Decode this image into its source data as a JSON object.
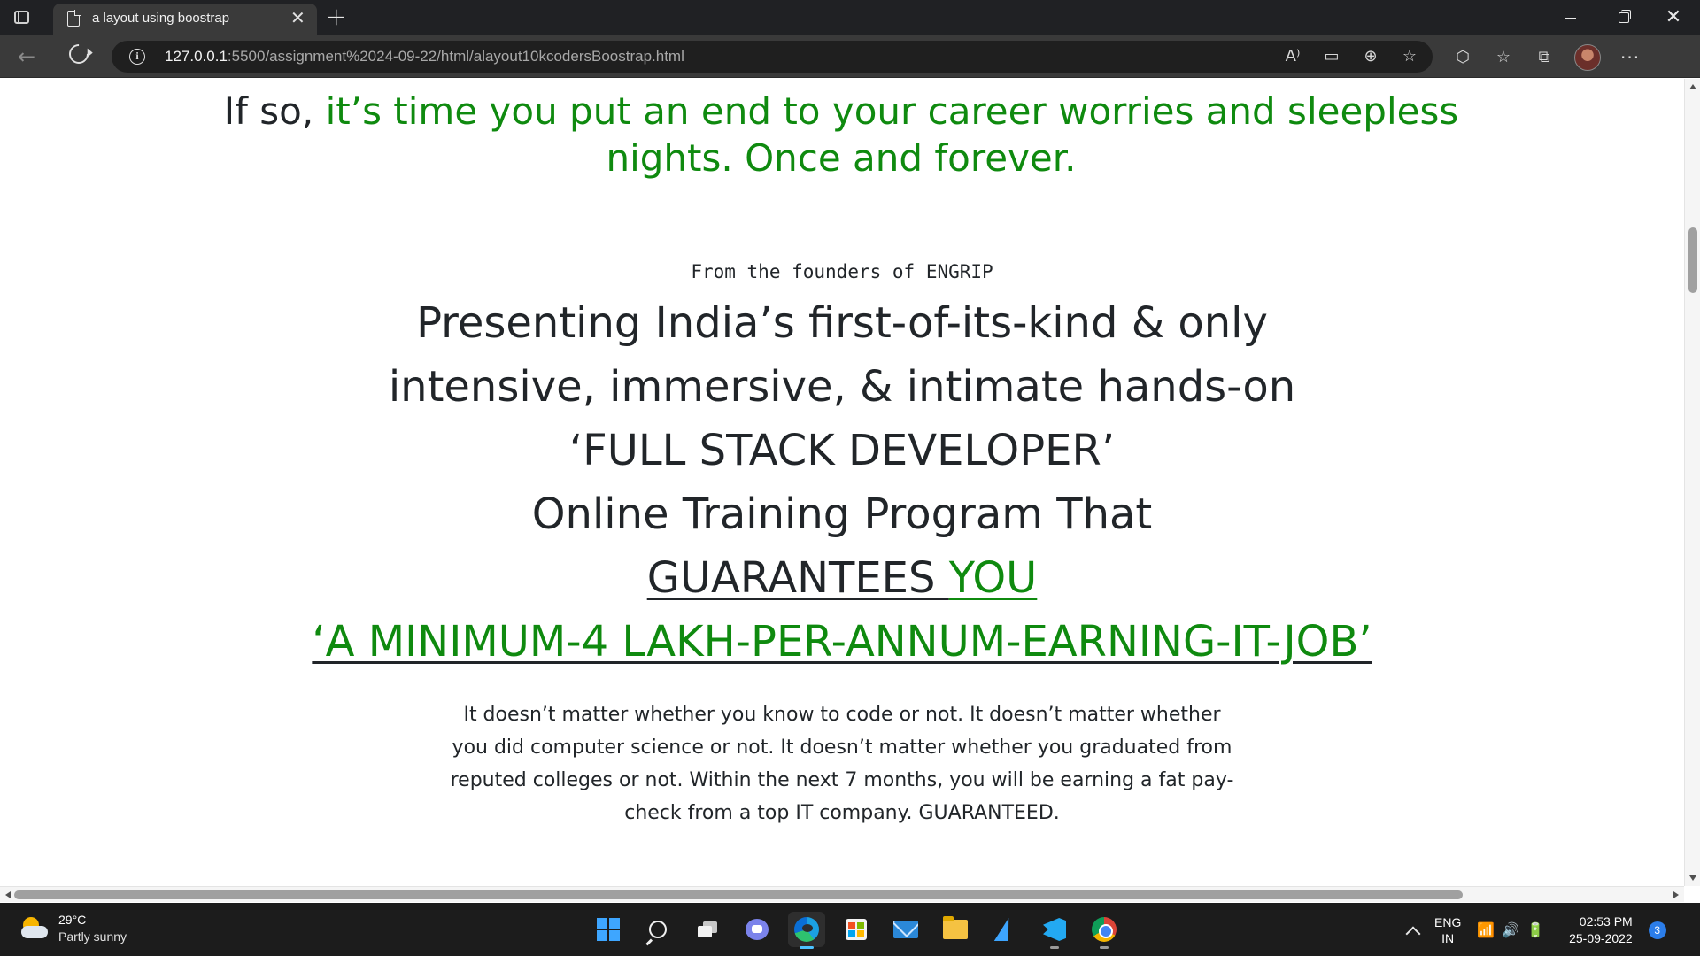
{
  "browser": {
    "tab_title": "a layout using boostrap",
    "tab_close": "✕",
    "new_tab": "+",
    "url_host": "127.0.0.1",
    "url_path": ":5500/assignment%2024-09-22/html/alayout10kcodersBoostrap.html"
  },
  "page": {
    "hero_prefix": "If so, ",
    "hero_green": "it’s time you put an end to your career worries and sleepless nights. Once and forever.",
    "founders": "From the founders of ENGRIP",
    "headline_1": "Presenting India’s first-of-its-kind & only",
    "headline_2": "intensive, immersive, & intimate hands-on",
    "headline_3": "‘FULL STACK DEVELOPER’",
    "headline_4": "Online Training Program That",
    "guarantee_dark": "GUARANTEES ",
    "guarantee_green": "YOU",
    "job_line": "‘A MINIMUM-4 LAKH-PER-ANNUM-EARNING-IT-JOB’",
    "description": "It doesn’t matter whether you know to code or not. It doesn’t matter whether you did computer science or not. It doesn’t matter whether you graduated from reputed colleges or not. Within the next 7 months, you will be earning a fat pay-check from a top IT company. GUARANTEED."
  },
  "colors": {
    "accent_green": "#0f8a0f",
    "text_dark": "#212529"
  },
  "taskbar": {
    "weather_temp": "29°C",
    "weather_desc": "Partly sunny",
    "lang_1": "ENG",
    "lang_2": "IN",
    "time": "02:53 PM",
    "date": "25-09-2022",
    "notifications": "3"
  }
}
